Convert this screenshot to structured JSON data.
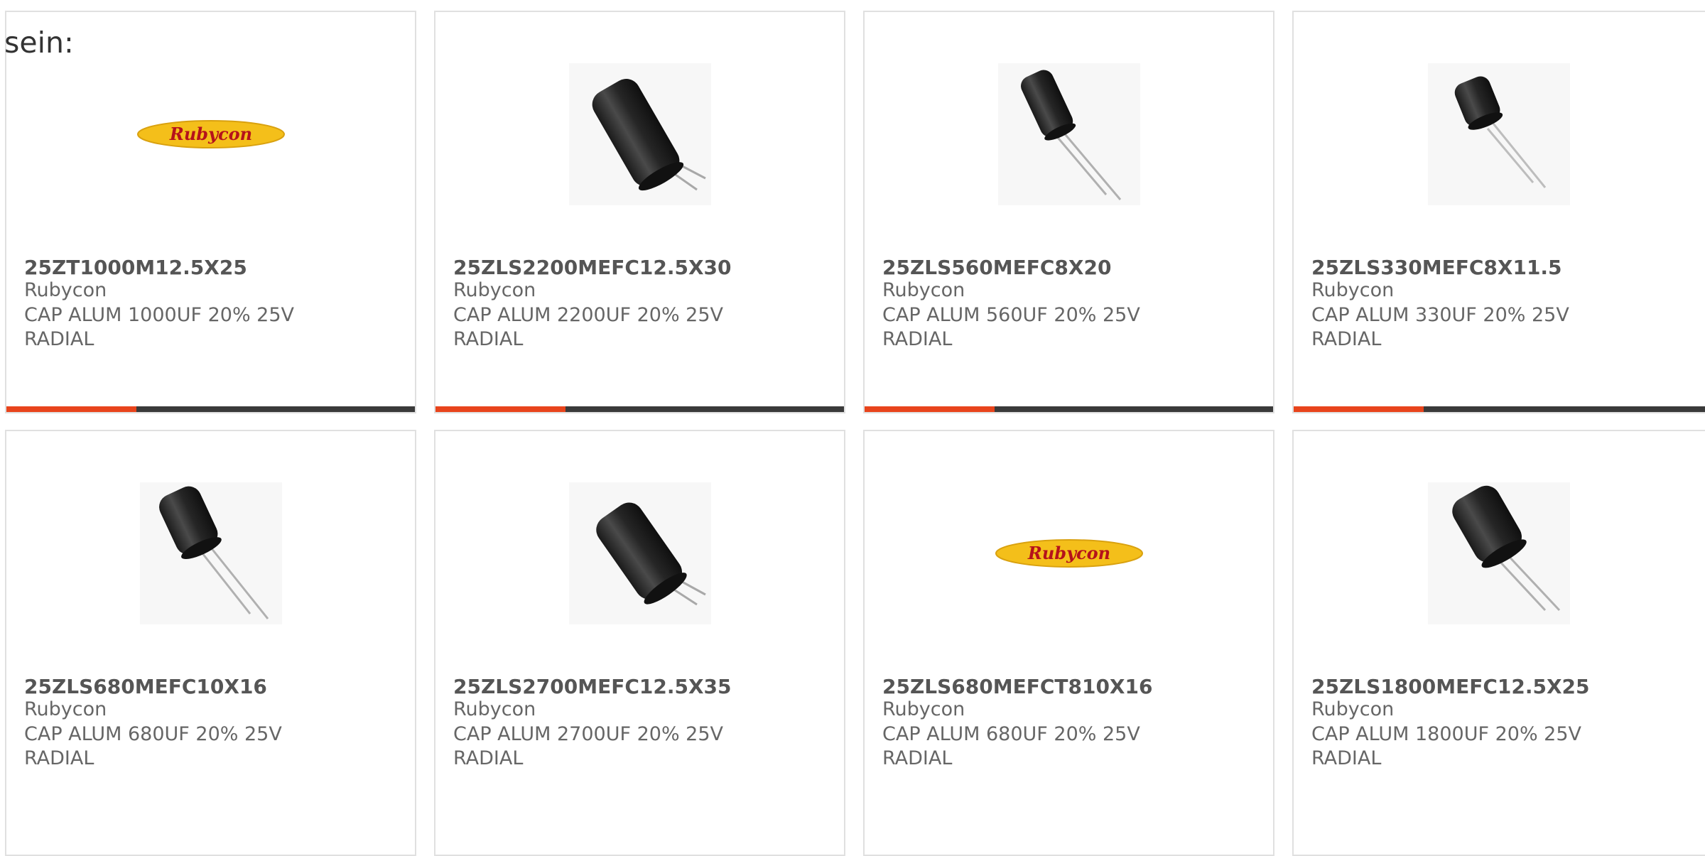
{
  "intro_text": "sein:",
  "colors": {
    "accent": "#e8441c",
    "bar_base": "#3a3a3a",
    "logo_yellow": "#f4bf1a",
    "logo_red": "#c8102e"
  },
  "products": [
    {
      "part": "25ZT1000M12.5X25",
      "maker": "Rubycon",
      "description": "CAP ALUM 1000UF 20% 25V RADIAL",
      "image": "rubycon-logo"
    },
    {
      "part": "25ZLS2200MEFC12.5X30",
      "maker": "Rubycon",
      "description": "CAP ALUM 2200UF 20% 25V RADIAL",
      "image": "capacitor-long"
    },
    {
      "part": "25ZLS560MEFC8X20",
      "maker": "Rubycon",
      "description": "CAP ALUM 560UF 20% 25V RADIAL",
      "image": "capacitor-slim"
    },
    {
      "part": "25ZLS330MEFC8X11.5",
      "maker": "Rubycon",
      "description": "CAP ALUM 330UF 20% 25V RADIAL",
      "image": "capacitor-small"
    },
    {
      "part": "25ZLS680MEFC10X16",
      "maker": "Rubycon",
      "description": "CAP ALUM 680UF 20% 25V RADIAL",
      "image": "capacitor-medium"
    },
    {
      "part": "25ZLS2700MEFC12.5X35",
      "maker": "Rubycon",
      "description": "CAP ALUM 2700UF 20% 25V RADIAL",
      "image": "capacitor-long"
    },
    {
      "part": "25ZLS680MEFCT810X16",
      "maker": "Rubycon",
      "description": "CAP ALUM 680UF 20% 25V RADIAL",
      "image": "rubycon-logo"
    },
    {
      "part": "25ZLS1800MEFC12.5X25",
      "maker": "Rubycon",
      "description": "CAP ALUM 1800UF 20% 25V RADIAL",
      "image": "capacitor-medium"
    }
  ]
}
